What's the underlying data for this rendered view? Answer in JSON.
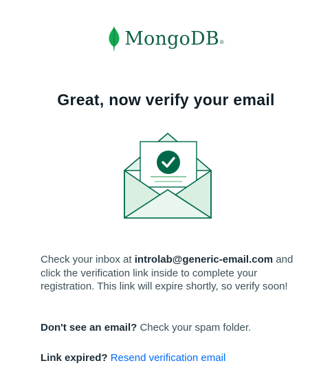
{
  "brand": {
    "name": "MongoDB",
    "registered_mark": "®",
    "leaf_color": "#13aa52",
    "text_color": "#116149"
  },
  "heading": "Great, now verify your email",
  "message": {
    "prefix": "Check your inbox at ",
    "email": "introlab@generic-email.com",
    "suffix": " and click the verification link inside to complete your registration. This link will expire shortly, so verify soon!"
  },
  "spam": {
    "question": "Don't see an email?",
    "hint": " Check your spam folder."
  },
  "expired": {
    "question": "Link expired?",
    "link_label": "Resend verification email"
  },
  "icons": {
    "envelope": "envelope-check-icon",
    "check": "checkmark-icon",
    "logo": "mongodb-leaf-icon"
  },
  "colors": {
    "accent_green": "#00684a",
    "link_blue": "#016bf8"
  }
}
